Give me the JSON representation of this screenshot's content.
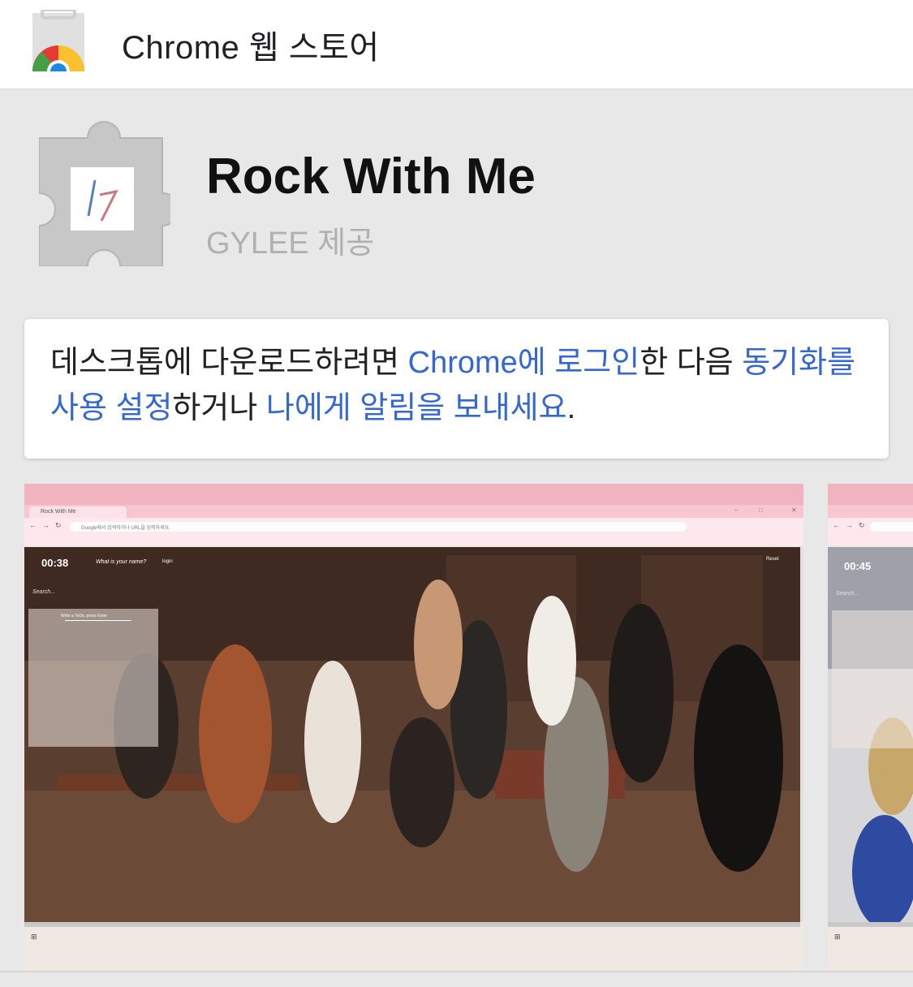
{
  "header": {
    "store_title": "Chrome 웹 스토어",
    "store_logo_icon": "chrome-web-store-icon"
  },
  "extension": {
    "name": "Rock With Me",
    "author": "GYLEE 제공",
    "icon": "puzzle-piece-icon",
    "thumb_text": "17"
  },
  "notice": {
    "part1": "데스크톱에 다운로드하려면 ",
    "link_chrome": "Chrome",
    "link_login": "에 로그인",
    "part2": "한 다음 ",
    "link_sync": "동기화를 사용 설정",
    "part3": "하거나 ",
    "link_remind": "나에게 알림을 보내세요",
    "part4": ".",
    "link_color": "#3367d6"
  },
  "screenshot1": {
    "tab_label": "Rock With Me",
    "url_placeholder": "Google에서 검색하거나 URL을 입력하세요.",
    "time": "00:38",
    "name_prompt": "What is your name?",
    "login": "login",
    "reset": "Reset",
    "search": "Search...",
    "todo_placeholder": "Write a ToDo, press Enter"
  },
  "screenshot2": {
    "time": "00:45",
    "search": "Search..."
  },
  "colors": {
    "accent": "#3367d6",
    "pink_frame": "#f2b3c0",
    "page_bg": "#e8e8e8"
  }
}
